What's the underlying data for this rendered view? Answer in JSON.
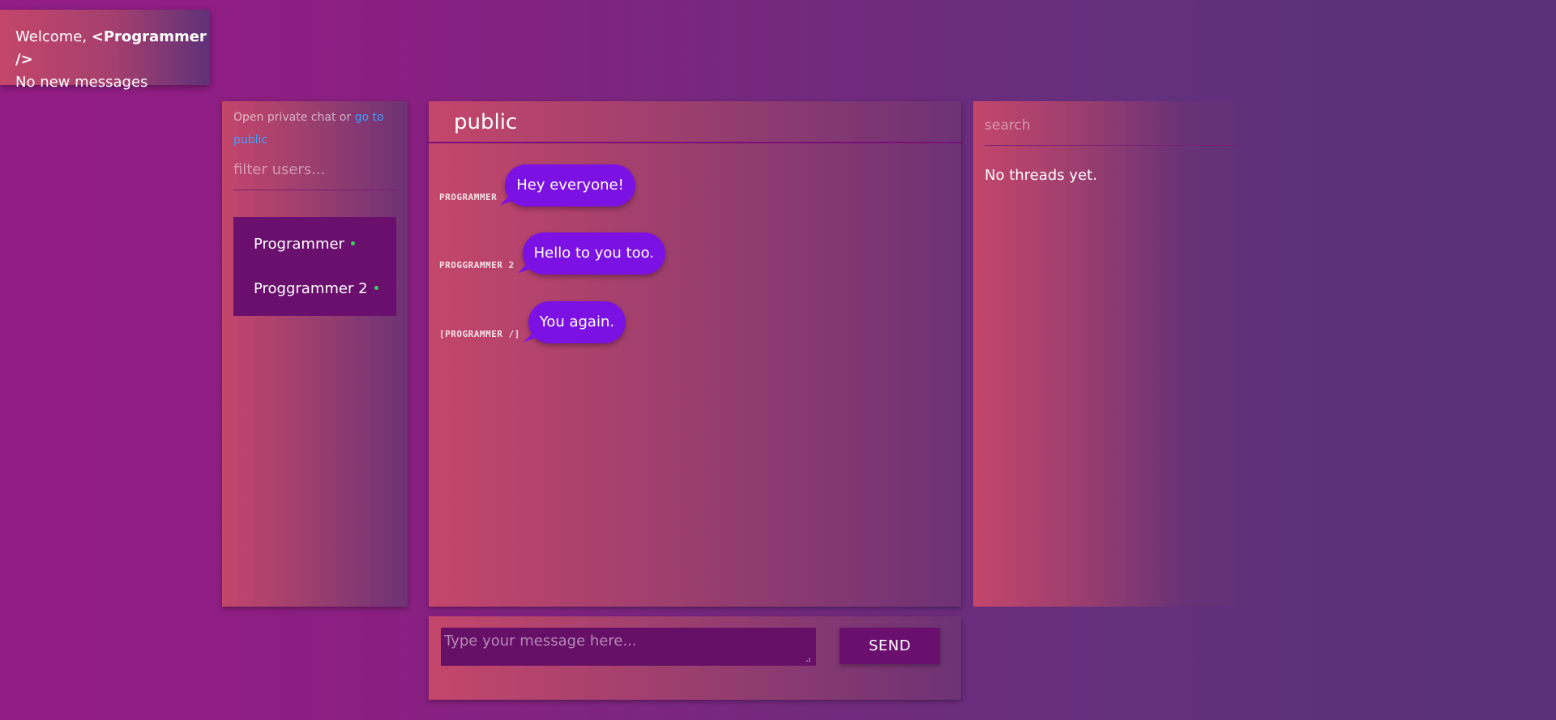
{
  "welcome": {
    "prefix": "Welcome, ",
    "username": "<Programmer />",
    "status": "No new messages"
  },
  "users_panel": {
    "hint_text": "Open private chat or ",
    "hint_link": "go to public",
    "filter_placeholder": "filter users...",
    "users": [
      {
        "name": "Programmer",
        "online": true
      },
      {
        "name": "Proggrammer 2",
        "online": true
      }
    ]
  },
  "chat": {
    "channel": "public",
    "messages": [
      {
        "sender": "Programmer",
        "text": "Hey everyone!"
      },
      {
        "sender": "Proggrammer 2",
        "text": "Hello to you too."
      },
      {
        "sender": "[Programmer /]",
        "text": "You again."
      }
    ],
    "composer": {
      "placeholder": "Type your message here...",
      "send_label": "SEND"
    }
  },
  "threads": {
    "search_placeholder": "search",
    "empty_text": "No threads yet."
  },
  "colors": {
    "bubble": "#7b11e3",
    "online_dot": "#39d15a",
    "link": "#3aa0ff",
    "dark_purple": "#6a0f6e"
  }
}
